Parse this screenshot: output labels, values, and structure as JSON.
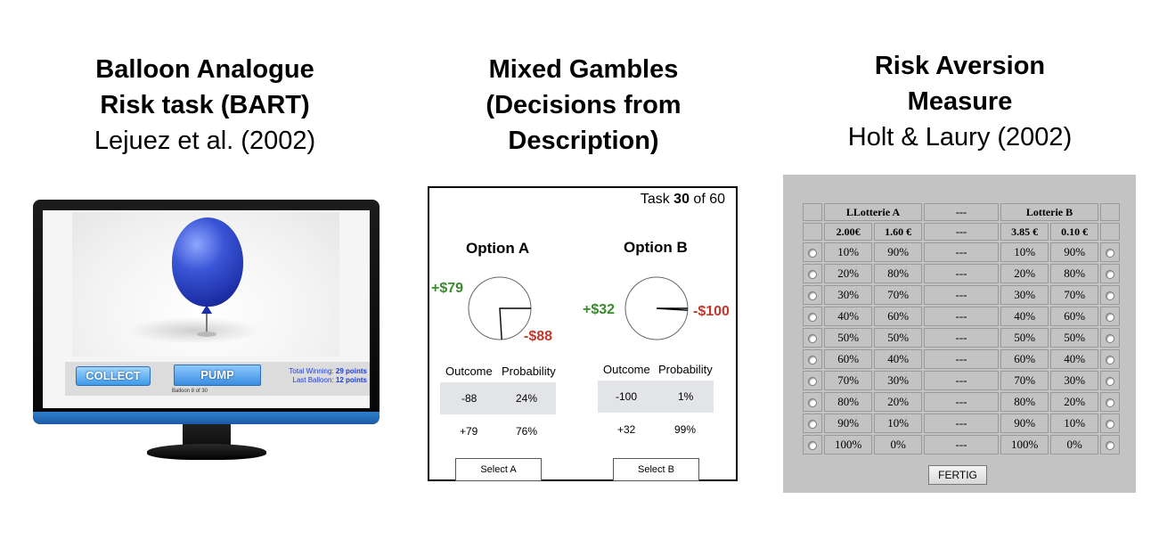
{
  "headings": {
    "bart": {
      "line1": "Balloon Analogue",
      "line2": "Risk task (BART)",
      "cite": "Lejuez et al. (2002)"
    },
    "mixed": {
      "line1": "Mixed Gambles",
      "line2": "(Decisions from",
      "line3": "Description)"
    },
    "risk": {
      "line1": "Risk Aversion",
      "line2": "Measure",
      "cite": "Holt & Laury (2002)"
    }
  },
  "bart": {
    "collect_label": "COLLECT",
    "pump_label": "PUMP",
    "total_label": "Total Winning:",
    "total_value": "29 points",
    "last_label": "Last Balloon:",
    "last_value": "12 points",
    "balloon_counter": "Balloon 8 of 30",
    "colors": {
      "balloon": "#2a3fc2",
      "button": "#3e9ae8",
      "stats_text": "#1e3fd6"
    }
  },
  "mixed": {
    "task_prefix": "Task ",
    "task_current": "30",
    "task_suffix": " of 60",
    "option_a": {
      "title": "Option A",
      "gain": "+$79",
      "loss": "-$88",
      "loss_probability": 0.24,
      "outcome_header": "Outcome",
      "probability_header": "Probability",
      "rows": [
        {
          "outcome": "-88",
          "probability": "24%"
        },
        {
          "outcome": "+79",
          "probability": "76%"
        }
      ],
      "select_label": "Select A"
    },
    "option_b": {
      "title": "Option B",
      "gain": "+$32",
      "loss": "-$100",
      "loss_probability": 0.01,
      "outcome_header": "Outcome",
      "probability_header": "Probability",
      "rows": [
        {
          "outcome": "-100",
          "probability": "1%"
        },
        {
          "outcome": "+32",
          "probability": "99%"
        }
      ],
      "select_label": "Select B"
    },
    "colors": {
      "gain": "#3a8a2e",
      "loss": "#c0392b"
    }
  },
  "holt_laury": {
    "lottery_a_title": "LLotterie A",
    "separator": "---",
    "lottery_b_title": "Lotterie B",
    "a_payoffs": [
      "2.00€",
      "1.60 €"
    ],
    "b_payoffs": [
      "3.85 €",
      "0.10 €"
    ],
    "rows": [
      {
        "a1": "10%",
        "a2": "90%",
        "b1": "10%",
        "b2": "90%"
      },
      {
        "a1": "20%",
        "a2": "80%",
        "b1": "20%",
        "b2": "80%"
      },
      {
        "a1": "30%",
        "a2": "70%",
        "b1": "30%",
        "b2": "70%"
      },
      {
        "a1": "40%",
        "a2": "60%",
        "b1": "40%",
        "b2": "60%"
      },
      {
        "a1": "50%",
        "a2": "50%",
        "b1": "50%",
        "b2": "50%"
      },
      {
        "a1": "60%",
        "a2": "40%",
        "b1": "60%",
        "b2": "40%"
      },
      {
        "a1": "70%",
        "a2": "30%",
        "b1": "70%",
        "b2": "30%"
      },
      {
        "a1": "80%",
        "a2": "20%",
        "b1": "80%",
        "b2": "20%"
      },
      {
        "a1": "90%",
        "a2": "10%",
        "b1": "90%",
        "b2": "10%"
      },
      {
        "a1": "100%",
        "a2": "0%",
        "b1": "100%",
        "b2": "0%"
      }
    ],
    "submit_label": "FERTIG",
    "colors": {
      "background": "#c3c3c3"
    }
  }
}
